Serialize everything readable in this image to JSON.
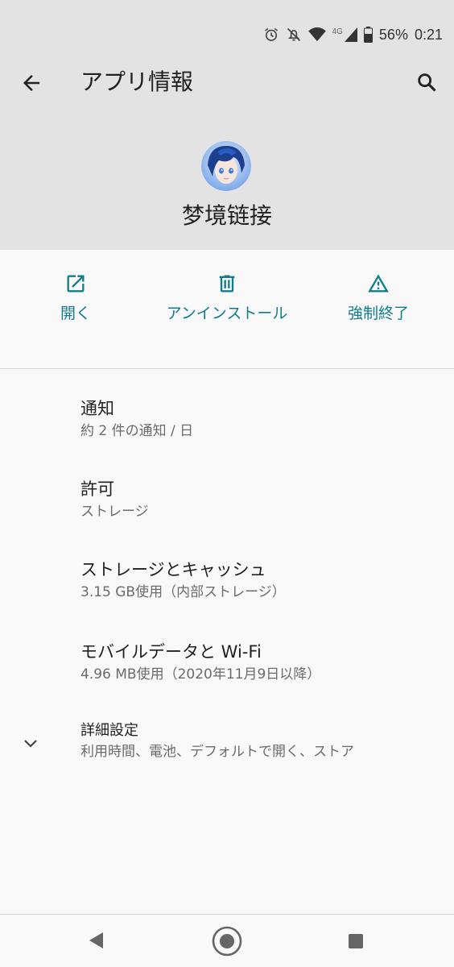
{
  "status_bar": {
    "network": "4G",
    "battery": "56%",
    "time": "0:21"
  },
  "toolbar": {
    "title": "アプリ情報"
  },
  "app": {
    "name": "梦境链接"
  },
  "actions": [
    {
      "label": "開く",
      "icon": "open-in-new-icon"
    },
    {
      "label": "アンインストール",
      "icon": "trash-icon"
    },
    {
      "label": "強制終了",
      "icon": "warning-icon"
    }
  ],
  "settings": [
    {
      "title": "通知",
      "subtitle": "約 2 件の通知 / 日"
    },
    {
      "title": "許可",
      "subtitle": "ストレージ"
    },
    {
      "title": "ストレージとキャッシュ",
      "subtitle": "3.15 GB使用（内部ストレージ）"
    },
    {
      "title": "モバイルデータと Wi-Fi",
      "subtitle": "4.96 MB使用（2020年11月9日以降）"
    },
    {
      "title": "詳細設定",
      "subtitle": "利用時間、電池、デフォルトで開く、ストア"
    }
  ],
  "colors": {
    "accent": "#117c8c",
    "header_bg": "#e3e3e3",
    "page_bg": "#f9f9f9"
  }
}
